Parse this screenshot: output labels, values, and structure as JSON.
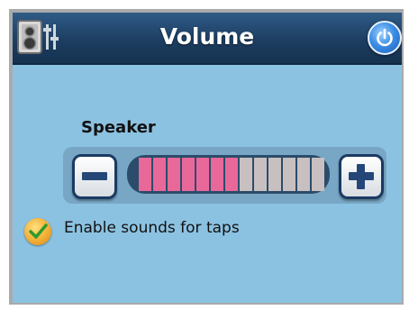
{
  "header": {
    "title": "Volume",
    "left_icon": "speaker-icon",
    "right_icon": "power-icon"
  },
  "volume": {
    "label": "Speaker",
    "level": 7,
    "max": 13,
    "minus_icon": "minus-icon",
    "plus_icon": "plus-icon",
    "active_color": "#e8689a",
    "inactive_color": "#c8c0c0"
  },
  "options": {
    "tap_sounds_label": "Enable sounds for taps",
    "tap_sounds_checked": true
  }
}
